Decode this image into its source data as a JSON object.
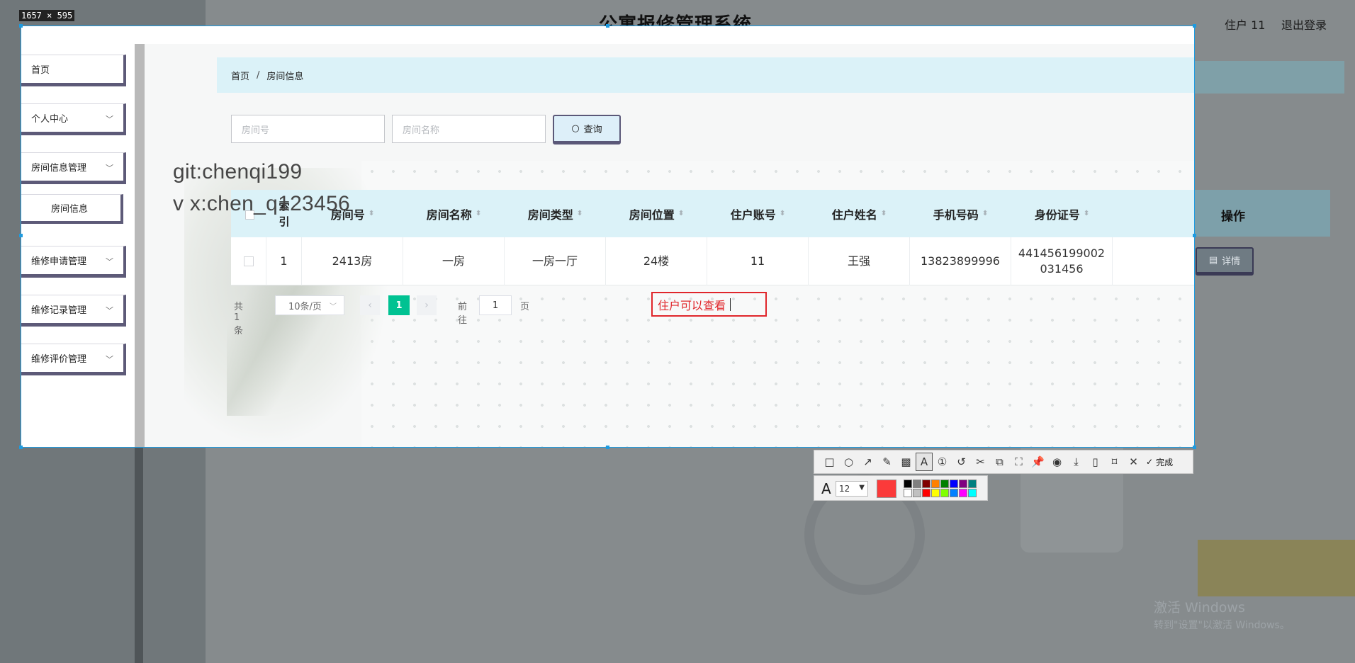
{
  "header": {
    "title": "公寓报修管理系统",
    "user": "住户 11",
    "logout": "退出登录"
  },
  "dimension_label": "1657 × 595",
  "sidebar": {
    "items": [
      {
        "label": "首页",
        "has_children": false
      },
      {
        "label": "个人中心",
        "has_children": true
      },
      {
        "label": "房间信息管理",
        "has_children": true
      },
      {
        "label": "房间信息",
        "sub": true
      },
      {
        "label": "维修申请管理",
        "has_children": true
      },
      {
        "label": "维修记录管理",
        "has_children": true
      },
      {
        "label": "维修评价管理",
        "has_children": true
      }
    ]
  },
  "breadcrumb": {
    "home": "首页",
    "separator": "/",
    "current": "房间信息"
  },
  "search": {
    "room_no_placeholder": "房间号",
    "room_name_placeholder": "房间名称",
    "query_label": "查询"
  },
  "table": {
    "headers": [
      "索引",
      "房间号",
      "房间名称",
      "房间类型",
      "房间位置",
      "住户账号",
      "住户姓名",
      "手机号码",
      "身份证号",
      "操作"
    ],
    "rows": [
      {
        "index": "1",
        "room_no": "2413房",
        "room_name": "一房",
        "room_type": "一房一厅",
        "location": "24楼",
        "account": "11",
        "name": "王强",
        "phone": "13823899996",
        "id_card": "441456199002031456",
        "action": "详情"
      }
    ]
  },
  "pager": {
    "total": "共 1 条",
    "page_size": "10条/页",
    "current_page": "1",
    "goto_label": "前往",
    "goto_value": "1",
    "page_unit": "页"
  },
  "watermark": {
    "line1": "git:chenqi199",
    "line2": "v x:chen_q123456"
  },
  "annotation": {
    "text": "住户可以查看"
  },
  "toolbar": {
    "done_label": "完成",
    "font_size": "12",
    "current_color": "#fb3a3a"
  },
  "palette": [
    "#000000",
    "#808080",
    "#800000",
    "#ff8000",
    "#008000",
    "#0000ff",
    "#800080",
    "#008080",
    "#ffffff",
    "#c0c0c0",
    "#ff0000",
    "#ffff00",
    "#80ff00",
    "#0080ff",
    "#ff00ff",
    "#00ffff"
  ],
  "os_watermark": {
    "line1": "激活 Windows",
    "line2": "转到\"设置\"以激活 Windows。"
  }
}
